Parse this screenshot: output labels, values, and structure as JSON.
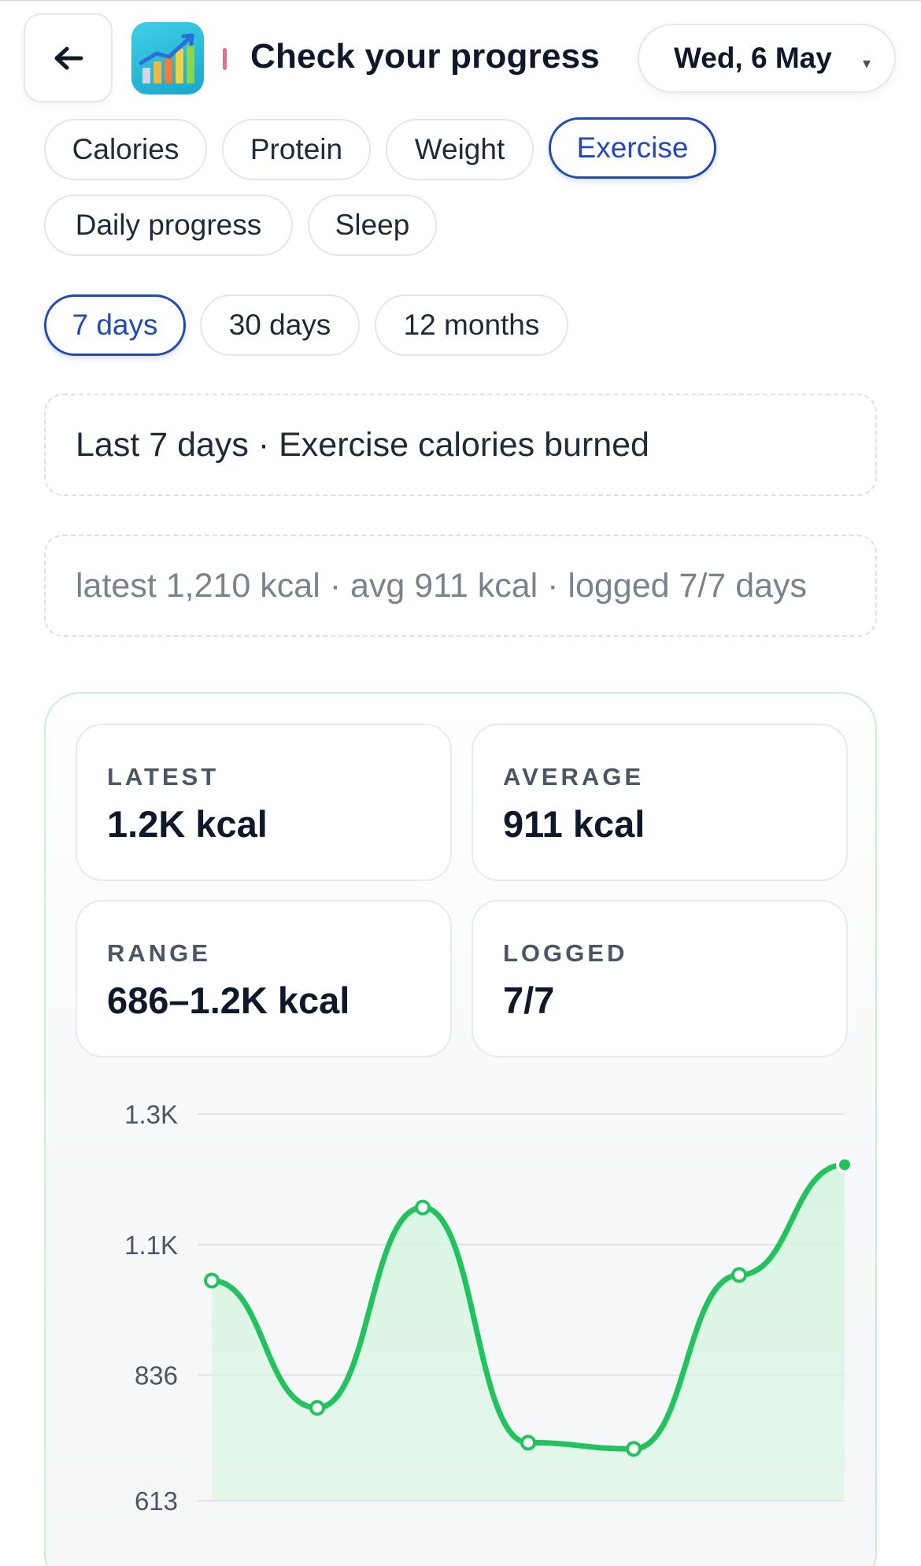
{
  "header": {
    "title": "Check your progress",
    "date": "Wed, 6 May",
    "date_caret": "▾"
  },
  "metric_tabs": [
    {
      "label": "Calories",
      "active": false
    },
    {
      "label": "Protein",
      "active": false
    },
    {
      "label": "Weight",
      "active": false
    },
    {
      "label": "Exercise",
      "active": true
    },
    {
      "label": "Daily progress",
      "active": false
    },
    {
      "label": "Sleep",
      "active": false
    }
  ],
  "range_tabs": [
    {
      "label": "7 days",
      "active": true
    },
    {
      "label": "30 days",
      "active": false
    },
    {
      "label": "12 months",
      "active": false
    }
  ],
  "summary": {
    "title": "Last 7 days · Exercise calories burned",
    "subtitle": "latest 1,210 kcal · avg 911 kcal · logged 7/7 days"
  },
  "stats": {
    "latest": {
      "label": "LATEST",
      "value": "1.2K kcal"
    },
    "average": {
      "label": "AVERAGE",
      "value": "911 kcal"
    },
    "range": {
      "label": "RANGE",
      "value": "686–1.2K kcal"
    },
    "logged": {
      "label": "LOGGED",
      "value": "7/7"
    }
  },
  "colors": {
    "accent": "#2349b8",
    "line": "#22c25e",
    "fill": "#d7f5e1"
  },
  "chart_data": {
    "type": "area",
    "series": [
      {
        "values": [
          1004,
          778,
          1134,
          716,
          705,
          1014,
          1210
        ]
      }
    ],
    "ylim": [
      613,
      1300
    ],
    "yticks": [
      {
        "value": 613,
        "label": "613"
      },
      {
        "value": 836,
        "label": "836"
      },
      {
        "value": 1068,
        "label": "1.1K"
      },
      {
        "value": 1300,
        "label": "1.3K"
      }
    ],
    "grid": true
  }
}
